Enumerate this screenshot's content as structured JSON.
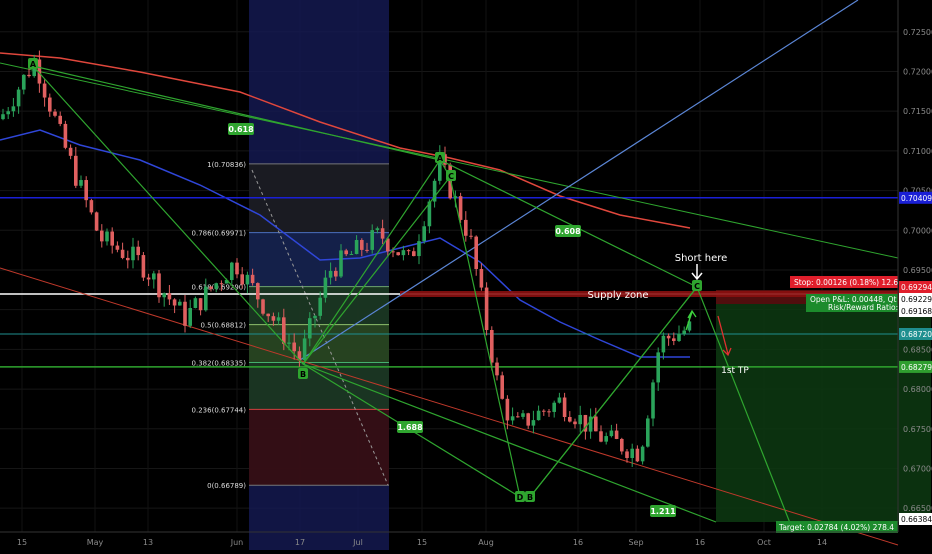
{
  "chart_data": {
    "type": "candlestick",
    "instrument_note": "",
    "y_axis": {
      "range": [
        0.662,
        0.729
      ],
      "tick_labels": [
        "0.72500",
        "0.72000",
        "0.71500",
        "0.71000",
        "0.70500",
        "0.70000",
        "0.69500",
        "0.69000",
        "0.68500",
        "0.68000",
        "0.67500",
        "0.67000",
        "0.66500"
      ]
    },
    "x_axis": {
      "tick_labels": [
        "15",
        "May",
        "13",
        "Jun",
        "17",
        "Jul",
        "15",
        "Aug",
        "16",
        "Sep",
        "16",
        "Oct",
        "14"
      ]
    },
    "price_labels": [
      {
        "text": "0.70409",
        "value": 0.70409,
        "color": "#1a1fd6"
      },
      {
        "text": "0.69294",
        "value": 0.69294,
        "color": "#e01e2b"
      },
      {
        "text": "0.69229",
        "value": 0.69229,
        "color": "#ffffff"
      },
      {
        "text": "0.69168",
        "value": 0.69168,
        "color": "#ffffff"
      },
      {
        "text": "0.68720",
        "value": 0.6872,
        "color": "#1f8f8f"
      },
      {
        "text": "0.68279",
        "value": 0.68279,
        "color": "#2f9e2f"
      },
      {
        "text": "0.66384",
        "value": 0.66384,
        "color": "#ffffff"
      }
    ],
    "fibonacci": {
      "levels": [
        {
          "label": "1(0.70836)",
          "value": 0.70836
        },
        {
          "label": "0.786(0.69971)",
          "value": 0.69971
        },
        {
          "label": "0.618(0.69290)",
          "value": 0.6929
        },
        {
          "label": "0.5(0.68812)",
          "value": 0.68812
        },
        {
          "label": "0.382(0.68335)",
          "value": 0.68335
        },
        {
          "label": "0.236(0.67744)",
          "value": 0.67744
        },
        {
          "label": "0(0.66789)",
          "value": 0.66789
        }
      ]
    },
    "pattern_points": [
      "A",
      "B",
      "A",
      "C",
      "D",
      "B",
      "C"
    ],
    "ratio_labels": [
      "0.618",
      "0.608",
      "1.688",
      "1.211"
    ],
    "annotations": {
      "short_here": "Short here",
      "supply_zone": "Supply zone",
      "first_tp": "1st TP",
      "stop": "Stop: 0.00126 (0.18%) 12.6",
      "open_pnl": "Open P&L: 0.00448, Qt",
      "risk_reward": "Risk/Reward Ratio:",
      "target": "Target: 0.02784 (4.02%) 278.4"
    },
    "colors": {
      "background": "#000000",
      "bull": "#2aa35a",
      "bear": "#e06060",
      "ma_red": "#e0473c",
      "ma_blue": "#2f46d8",
      "trend_green": "#2fa52f",
      "trend_red": "#c0392b",
      "blue_line": "#5b86d6",
      "horizontal_blue": "#1a1fd6"
    }
  }
}
